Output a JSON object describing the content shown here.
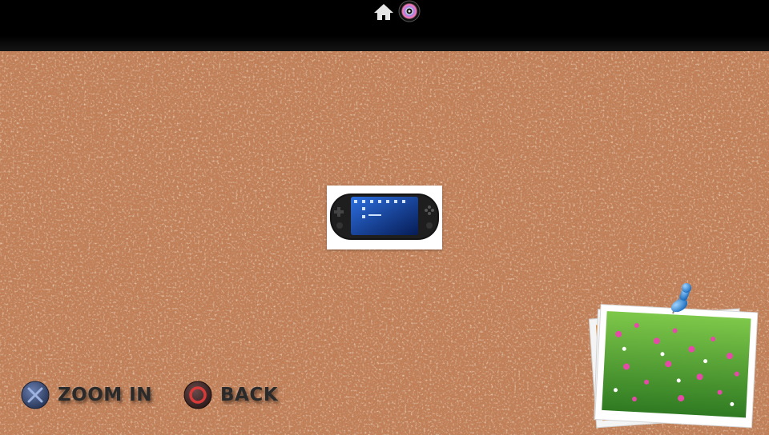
{
  "statusbar": {
    "home_icon": "home-icon",
    "app_icon": "app-disc-icon"
  },
  "main": {
    "thumbnail_icon": "handheld-console-thumbnail"
  },
  "controls": {
    "zoom_in": {
      "button_icon": "cross-button-icon",
      "label": "ZOOM IN"
    },
    "back": {
      "button_icon": "circle-button-icon",
      "label": "BACK"
    }
  },
  "widgets": {
    "photo_stack_icon": "pinned-photo-stack"
  },
  "colors": {
    "cork": "#c27d55",
    "topbar": "#000000",
    "hint_text": "#2a2a2a",
    "cross_button": "#3a4e7a",
    "circle_button": "#b03030",
    "pin": "#2f86d6"
  }
}
